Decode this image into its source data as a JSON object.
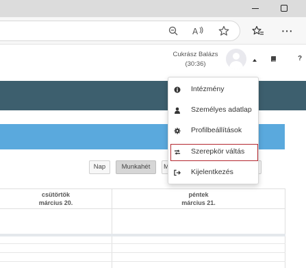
{
  "browser": {
    "icons": [
      "zoom-out-icon",
      "read-aloud-icon",
      "favorite-star-icon",
      "favorites-list-icon",
      "more-options-icon"
    ],
    "more_label": "···"
  },
  "header": {
    "user_name": "Cukrász Balázs",
    "session_time": "(30:36)",
    "help_label": "?"
  },
  "user_menu": {
    "items": [
      {
        "label": "Intézmény",
        "icon": "info-icon"
      },
      {
        "label": "Személyes adatlap",
        "icon": "user-icon"
      },
      {
        "label": "Profilbeállítások",
        "icon": "gear-icon"
      },
      {
        "label": "Szerepkör váltás",
        "icon": "switch-role-icon",
        "highlighted": true
      },
      {
        "label": "Kijelentkezés",
        "icon": "logout-icon"
      }
    ],
    "highlight_color": "#b3262e"
  },
  "calendar": {
    "view_buttons": [
      {
        "label": "Nap"
      },
      {
        "label": "Munkahét",
        "active": true
      },
      {
        "label": "M"
      },
      {
        "label": "t"
      }
    ],
    "days": [
      {
        "weekday": "csütörtök",
        "date": "március 20."
      },
      {
        "weekday": "péntek",
        "date": "március 21."
      }
    ]
  },
  "colors": {
    "header_band": "#3d5f6e",
    "sub_band": "#5aa9dd"
  }
}
